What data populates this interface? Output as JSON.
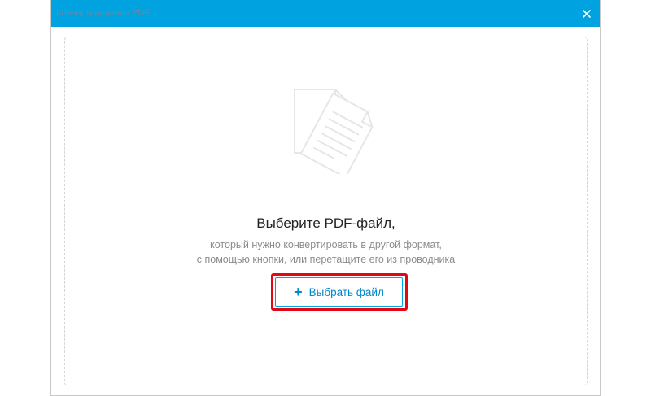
{
  "window": {
    "title": "Конвертирование PDF"
  },
  "dropzone": {
    "headline": "Выберите PDF-файл,",
    "subtitle_line1": "который нужно конвертировать в другой формат,",
    "subtitle_line2": "с помощью кнопки, или перетащите его из проводника"
  },
  "choose_button": {
    "icon": "plus-icon",
    "label": "Выбрать файл"
  },
  "colors": {
    "titlebar": "#00a3e0",
    "button_text": "#0088cc",
    "highlight": "#e30613"
  }
}
